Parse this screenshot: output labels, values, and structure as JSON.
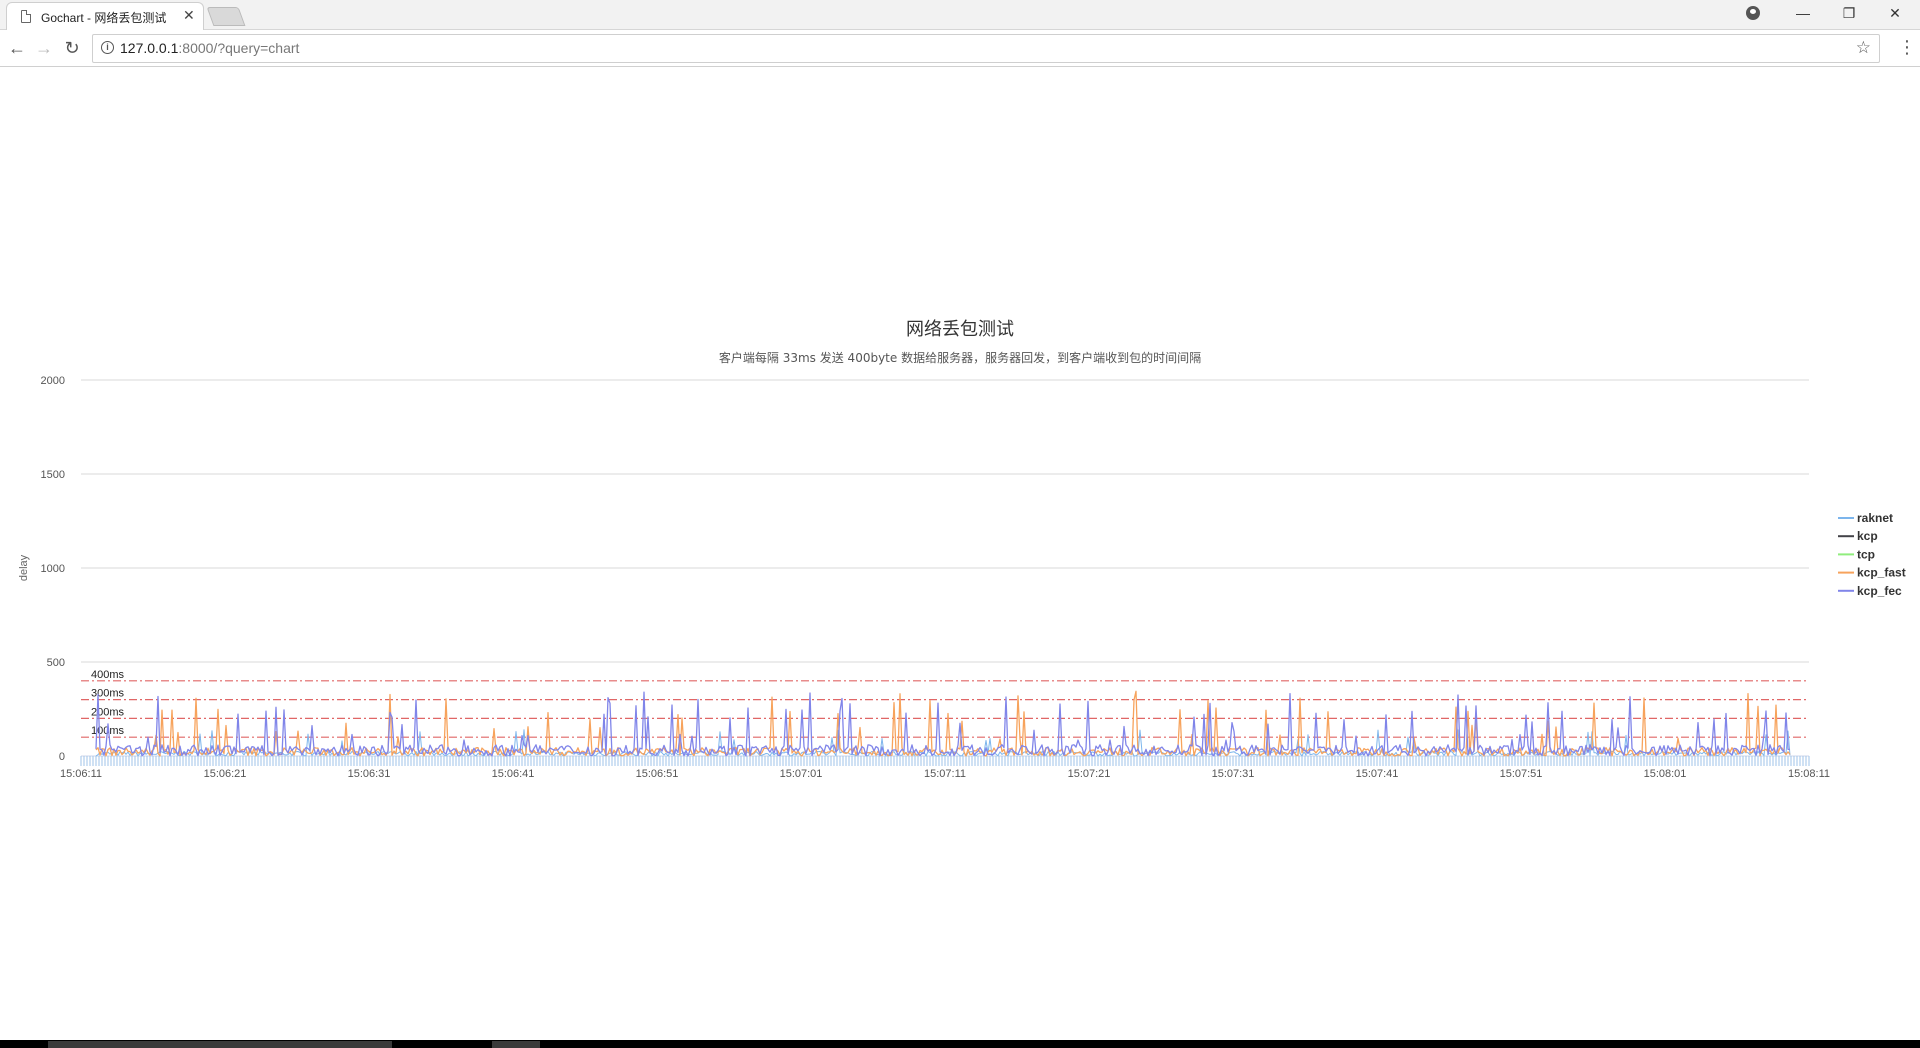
{
  "browser": {
    "tab_title": "Gochart - 网络丢包测试",
    "tab_close": "✕",
    "url_host": "127.0.0.1",
    "url_rest": ":8000/?query=chart",
    "window_controls": [
      "—",
      "❐",
      "✕"
    ]
  },
  "chart_data": {
    "type": "line",
    "title": "网络丢包测试",
    "subtitle": "客户端每隔 33ms 发送 400byte 数据给服务器，服务器回发，到客户端收到包的时间间隔",
    "ylabel": "delay",
    "xlabel": "",
    "ylim": [
      0,
      2000
    ],
    "yticks": [
      "0",
      "500",
      "1000",
      "1500",
      "2000"
    ],
    "xticks": [
      "15:06:11",
      "15:06:21",
      "15:06:31",
      "15:06:41",
      "15:06:51",
      "15:07:01",
      "15:07:11",
      "15:07:21",
      "15:07:31",
      "15:07:41",
      "15:07:51",
      "15:08:01",
      "15:08:11"
    ],
    "x_start": "15:06:11",
    "x_end": "15:08:11",
    "grid": true,
    "legend_position": "right",
    "plot_lines": [
      {
        "label": "400ms",
        "value": 400
      },
      {
        "label": "300ms",
        "value": 300
      },
      {
        "label": "200ms",
        "value": 200
      },
      {
        "label": "100ms",
        "value": 100
      }
    ],
    "series": [
      {
        "name": "raknet",
        "color": "#7cb5ec"
      },
      {
        "name": "kcp",
        "color": "#434348"
      },
      {
        "name": "tcp",
        "color": "#90ed7d"
      },
      {
        "name": "kcp_fast",
        "color": "#f7a35c"
      },
      {
        "name": "kcp_fec",
        "color": "#8085e9"
      }
    ],
    "colors": {
      "plot_line": "#e06666",
      "grid": "#d8d8d8"
    }
  }
}
